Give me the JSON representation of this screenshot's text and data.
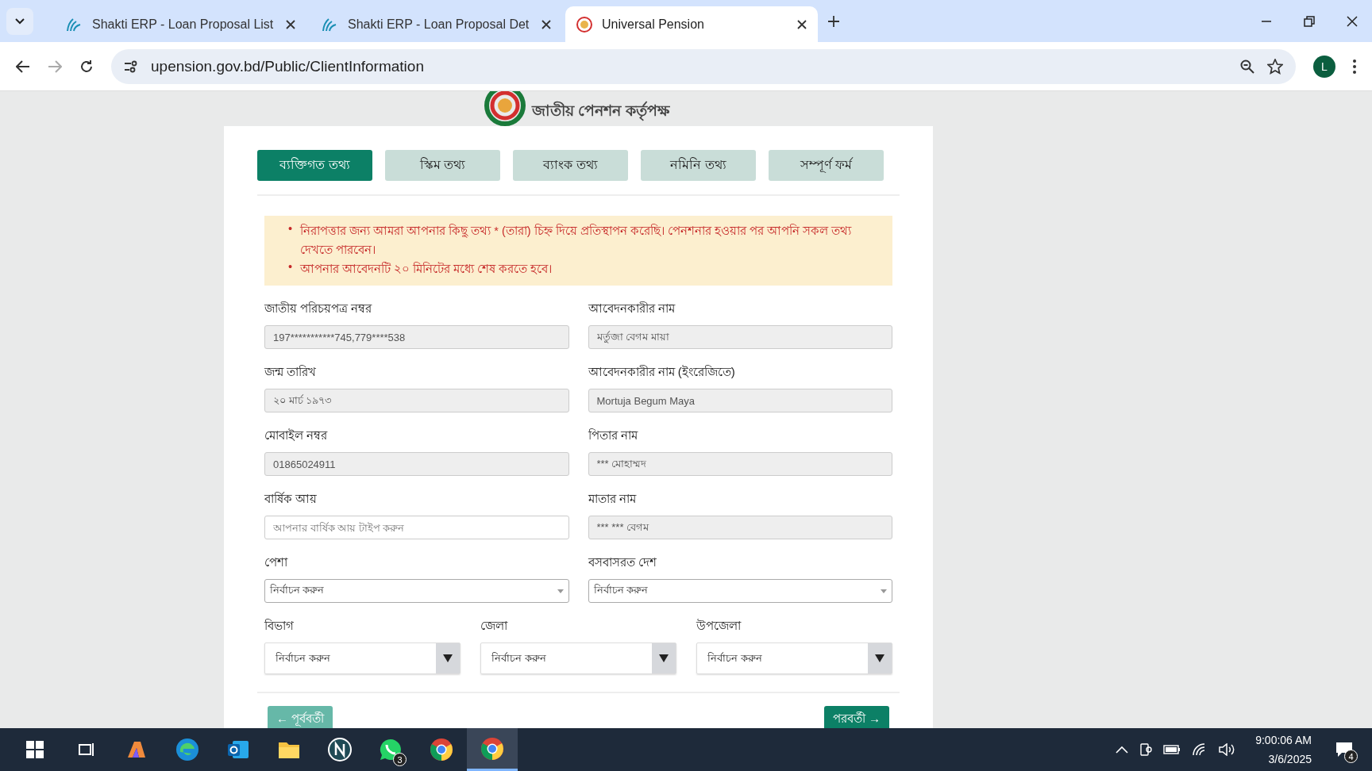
{
  "browser": {
    "tabs": [
      {
        "title": "Shakti ERP - Loan Proposal List",
        "selected": false
      },
      {
        "title": "Shakti ERP - Loan Proposal Det",
        "selected": false
      },
      {
        "title": "Universal Pension",
        "selected": true
      }
    ],
    "url": "upension.gov.bd/Public/ClientInformation",
    "profile": "L"
  },
  "header": {
    "org_name": "জাতীয় পেনশন কর্তৃপক্ষ"
  },
  "form_tabs": [
    {
      "label": "ব্যক্তিগত তথ্য",
      "selected": true
    },
    {
      "label": "স্কিম তথ্য",
      "selected": false
    },
    {
      "label": "ব্যাংক তথ্য",
      "selected": false
    },
    {
      "label": "নমিনি তথ্য",
      "selected": false
    },
    {
      "label": "সম্পূর্ণ ফর্ম",
      "selected": false
    }
  ],
  "notice": [
    {
      "marker": "•",
      "text": "নিরাপত্তার জন্য আমরা আপনার কিছু তথ্য * (তারা) চিহ্ন দিয়ে প্রতিস্থাপন করেছি। পেনশনার হওয়ার পর আপনি সকল তথ্য দেখতে পারবেন।"
    },
    {
      "marker": "•",
      "text": "আপনার আবেদনটি ২০ মিনিটের মধ্যে শেষ করতে হবে।"
    }
  ],
  "field_rows": [
    [
      {
        "kind": "text",
        "label": "জাতীয় পরিচয়পত্র নম্বর",
        "value": "197***********745,779****538",
        "disabled": true
      },
      {
        "kind": "text",
        "label": "আবেদনকারীর নাম",
        "value": "মর্তুজা বেগম মায়া",
        "disabled": true
      }
    ],
    [
      {
        "kind": "text",
        "label": "জন্ম তারিখ",
        "value": "২০ মার্চ ১৯৭৩",
        "disabled": true
      },
      {
        "kind": "text",
        "label": "আবেদনকারীর নাম (ইংরেজিতে)",
        "value": "Mortuja Begum Maya",
        "disabled": true
      }
    ],
    [
      {
        "kind": "text",
        "label": "মোবাইল নম্বর",
        "value": "01865024911",
        "disabled": true
      },
      {
        "kind": "text",
        "label": "পিতার নাম",
        "value": "*** মোহাম্মদ",
        "disabled": true
      }
    ],
    [
      {
        "kind": "text",
        "label": "বার্ষিক আয়",
        "placeholder": "আপনার বার্ষিক আয় টাইপ করুন",
        "disabled": false
      },
      {
        "kind": "text",
        "label": "মাতার নাম",
        "value": "*** *** বেগম",
        "disabled": true
      }
    ],
    [
      {
        "kind": "select",
        "label": "পেশা",
        "value": "নির্বাচন করুন"
      },
      {
        "kind": "select",
        "label": "বসবাসরত দেশ",
        "value": "নির্বাচন করুন"
      }
    ],
    [
      {
        "kind": "dropdown",
        "label": "বিভাগ",
        "value": "নির্বাচন করুন"
      },
      {
        "kind": "dropdown",
        "label": "জেলা",
        "value": "নির্বাচন করুন"
      },
      {
        "kind": "dropdown",
        "label": "উপজেলা",
        "value": "নির্বাচন করুন"
      }
    ]
  ],
  "nav_buttons": [
    {
      "label": "← পূর্ববর্তী",
      "disabled": true
    },
    {
      "label": "পরবর্তী →",
      "disabled": false
    }
  ],
  "taskbar": {
    "apps": [
      {
        "kind": "start"
      },
      {
        "kind": "taskview"
      },
      {
        "kind": "copilot"
      },
      {
        "kind": "edge"
      },
      {
        "kind": "outlook"
      },
      {
        "kind": "files"
      },
      {
        "kind": "n-app"
      },
      {
        "kind": "whatsapp",
        "badge": "3"
      },
      {
        "kind": "chrome"
      },
      {
        "kind": "chrome",
        "selected": true
      }
    ],
    "time": "9:00:06 AM",
    "date": "3/6/2025",
    "notifications": "4"
  }
}
